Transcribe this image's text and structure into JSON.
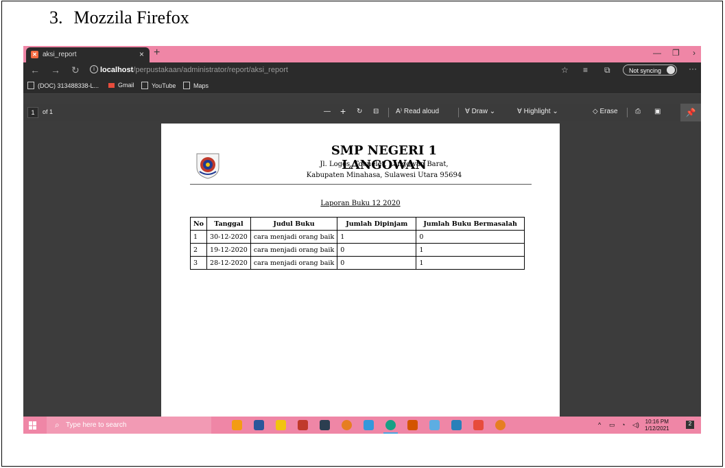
{
  "document": {
    "heading_number": "3.",
    "heading_text": "Mozzila Firefox"
  },
  "browser": {
    "tab_title": "aksi_report",
    "url_host": "localhost",
    "url_path": "/perpustakaan/administrator/report/aksi_report",
    "sync_label": "Not syncing",
    "bookmarks": [
      "(DOC) 313488338-L...",
      "Gmail",
      "YouTube",
      "Maps"
    ]
  },
  "pdf_toolbar": {
    "page_number": "1",
    "page_of": "of 1",
    "read_aloud": "Read aloud",
    "draw": "Draw",
    "highlight": "Highlight",
    "erase": "Erase"
  },
  "report": {
    "school_name": "SMP NEGERI 1 LANGOWAN",
    "address_line1": "Jl. Logos, Tounelet, Langowan Barat,",
    "address_line2": "Kabupaten Minahasa, Sulawesi Utara 95694",
    "title": "Laporan Buku 12 2020",
    "columns": [
      "No",
      "Tanggal",
      "Judul Buku",
      "Jumlah Dipinjam",
      "Jumlah Buku Bermasalah"
    ],
    "rows": [
      [
        "1",
        "30-12-2020",
        "cara menjadi orang baik",
        "1",
        "0"
      ],
      [
        "2",
        "19-12-2020",
        "cara menjadi orang baik",
        "0",
        "1"
      ],
      [
        "3",
        "28-12-2020",
        "cara menjadi orang baik",
        "0",
        "1"
      ]
    ]
  },
  "taskbar": {
    "search_placeholder": "Type here to search",
    "time": "10:16 PM",
    "date": "1/12/2021",
    "notification_count": "2"
  },
  "colors": {
    "accent_pink": "#ef86a6",
    "browser_dark": "#2b2b2b",
    "pdf_bg": "#3c3c3c"
  }
}
